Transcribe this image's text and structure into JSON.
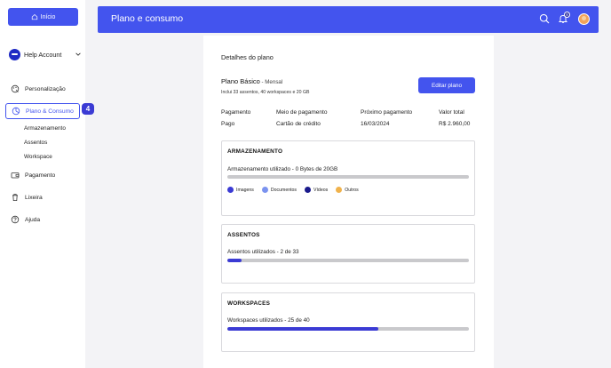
{
  "sidebar": {
    "home_label": "Início",
    "account_name": "Help Account",
    "items": [
      {
        "label": "Personalização"
      },
      {
        "label": "Plano & Consumo"
      },
      {
        "label": "Pagamento"
      },
      {
        "label": "Lixeira"
      },
      {
        "label": "Ajuda"
      }
    ],
    "sub_items": [
      "Armazenamento",
      "Assentos",
      "Workspace"
    ],
    "step_badge": "4"
  },
  "header": {
    "title": "Plano e consumo",
    "notification_count": "8"
  },
  "plan": {
    "section_title": "Detalhes do plano",
    "name": "Plano Básico",
    "frequency": " - Mensal",
    "description": "Inclui 33 assentos, 40 workspaces e 20 GB",
    "edit_label": "Editar plano",
    "columns": [
      {
        "header": "Pagamento",
        "value": "Pago"
      },
      {
        "header": "Meio de pagamento",
        "value": "Cartão de crédito"
      },
      {
        "header": "Próximo pagamento",
        "value": "16/03/2024"
      },
      {
        "header": "Valor total",
        "value": "R$ 2.960,00"
      }
    ]
  },
  "storage": {
    "title": "ARMAZENAMENTO",
    "label": "Armazenamento utilizado - 0 Bytes de 20GB",
    "fill_fraction": 0,
    "legend": [
      {
        "label": "Imagens",
        "color": "#3b3bd4"
      },
      {
        "label": "Documentos",
        "color": "#7b93ef"
      },
      {
        "label": "Vídeos",
        "color": "#1a1a8c"
      },
      {
        "label": "Outros",
        "color": "#f0b24c"
      }
    ]
  },
  "seats": {
    "title": "ASSENTOS",
    "label": "Assentos utilizados - 2 de 33",
    "fill_fraction": 0.06
  },
  "workspaces": {
    "title": "WORKSPACES",
    "label": "Workspaces utilizados - 25 de 40",
    "fill_fraction": 0.625
  }
}
